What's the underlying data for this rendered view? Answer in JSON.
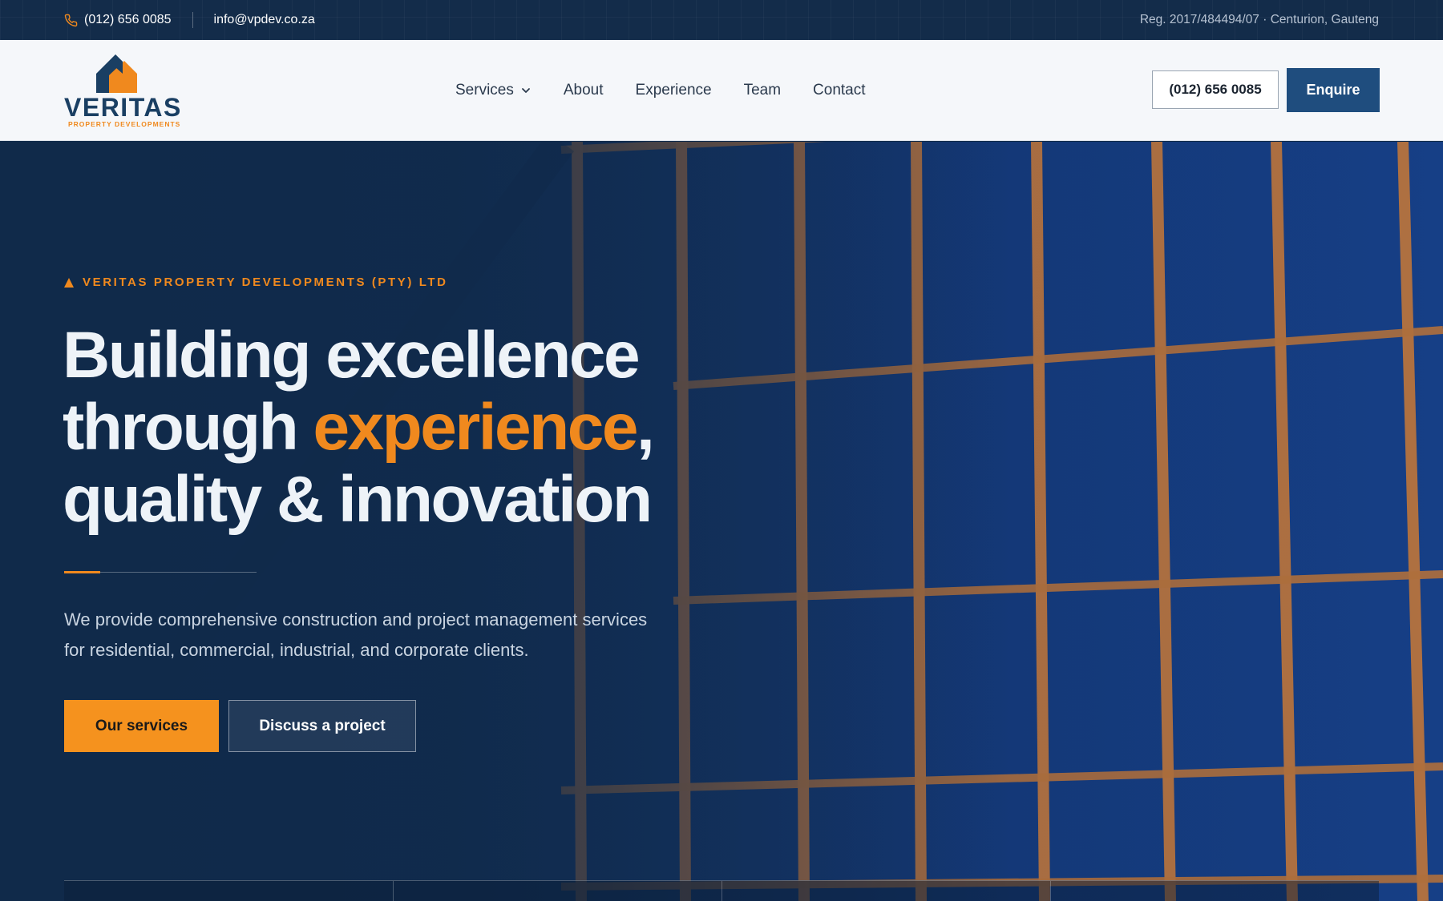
{
  "topbar": {
    "phone": "(012) 656 0085",
    "email": "info@vpdev.co.za",
    "registration": "Reg. 2017/484494/07 · Centurion, Gauteng"
  },
  "header": {
    "logo_word": "VERITAS",
    "logo_sub": "PROPERTY DEVELOPMENTS",
    "nav": [
      {
        "label": "Services",
        "has_dropdown": true
      },
      {
        "label": "About"
      },
      {
        "label": "Experience"
      },
      {
        "label": "Team"
      },
      {
        "label": "Contact"
      }
    ],
    "phone_button": "(012) 656 0085",
    "enquire_button": "Enquire"
  },
  "hero": {
    "eyebrow": "VERITAS PROPERTY DEVELOPMENTS (PTY) LTD",
    "headline_line1": "Building excellence",
    "headline_line2_pre": "through ",
    "headline_line2_accent": "experience",
    "headline_line2_post": ",",
    "headline_line3": "quality & innovation",
    "lead": "We provide comprehensive construction and project management services for residential, commercial, industrial, and corporate clients.",
    "primary_button": "Our services",
    "secondary_button": "Discuss a project"
  },
  "icons": {
    "phone": "phone-icon",
    "chevron": "chevron-down-icon",
    "logo_house": "house-logo-icon"
  },
  "colors": {
    "navy": "#132c4a",
    "brand_blue": "#1f4d7e",
    "accent_orange": "#f0891e",
    "header_bg": "#f5f7fa"
  }
}
